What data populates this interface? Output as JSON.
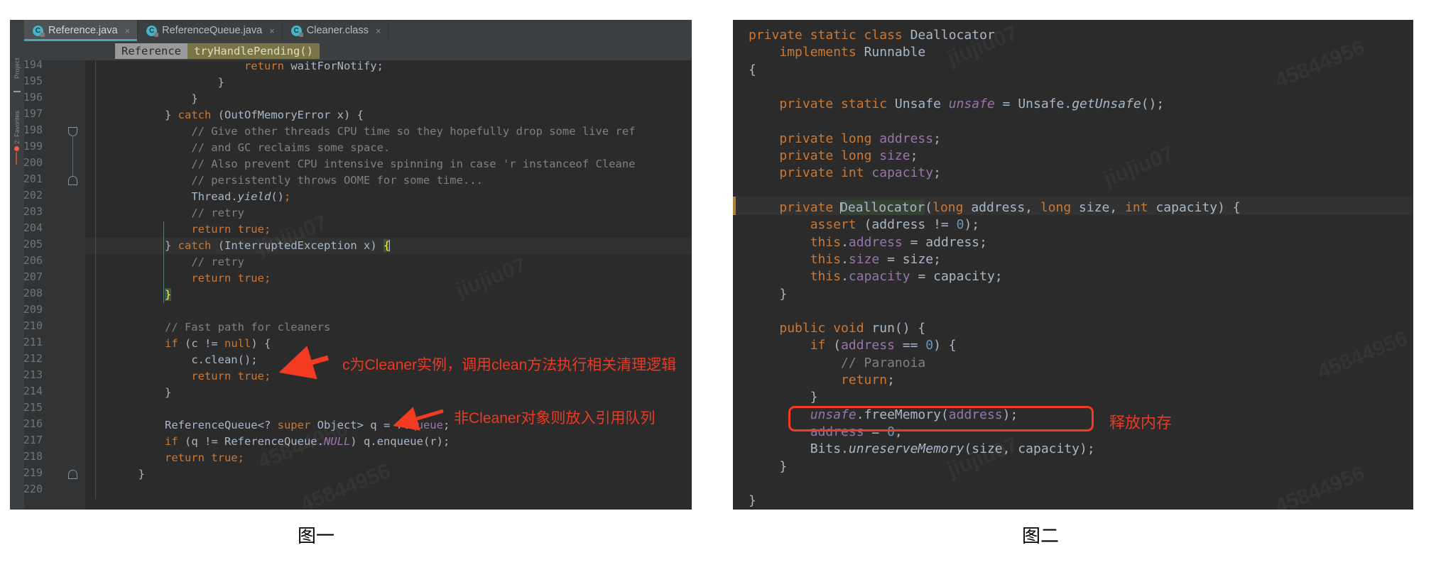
{
  "figure1": {
    "caption": "图一",
    "tabs": [
      {
        "label": "Reference.java",
        "icon": "java-class-icon",
        "close": "×",
        "active": true
      },
      {
        "label": "ReferenceQueue.java",
        "icon": "java-class-icon",
        "close": "×",
        "active": false
      },
      {
        "label": "Cleaner.class",
        "icon": "java-class-icon",
        "close": "×",
        "active": false
      }
    ],
    "breadcrumb": {
      "class": "Reference",
      "method": "tryHandlePending()"
    },
    "toolstrip": {
      "label_top": "Project",
      "label_bottom": "2: Favorites"
    },
    "gutter": {
      "first_line": 194,
      "last_line": 220
    },
    "code_lines": [
      {
        "n": 194,
        "html": "                        <span class='kw'>return</span> <span class='txt'>waitForNotify</span><span class='txt'>;</span>"
      },
      {
        "n": 195,
        "html": "                    <span class='txt'>}</span>"
      },
      {
        "n": 196,
        "html": "                <span class='txt'>}</span>"
      },
      {
        "n": 197,
        "html": "            <span class='txt'>}</span> <span class='kw'>catch</span> <span class='txt'>(OutOfMemoryError x) {</span>"
      },
      {
        "n": 198,
        "html": "                <span class='cmt'>// Give other threads CPU time so they hopefully drop some live ref</span>"
      },
      {
        "n": 199,
        "html": "                <span class='cmt'>// and GC reclaims some space.</span>"
      },
      {
        "n": 200,
        "html": "                <span class='cmt'>// Also prevent CPU intensive spinning in case 'r instanceof Cleane</span>"
      },
      {
        "n": 201,
        "html": "                <span class='cmt'>// persistently throws OOME for some time...</span>"
      },
      {
        "n": 202,
        "html": "                <span class='txt'>Thread.</span><span class='ital txt'>yield</span><span class='txt'>()</span><span class='kw'>;</span>"
      },
      {
        "n": 203,
        "html": "                <span class='cmt'>// retry</span>"
      },
      {
        "n": 204,
        "html": "                <span class='kw'>return true;</span>"
      },
      {
        "n": 205,
        "html": "            <span class='txt'>}</span> <span class='kw'>catch</span> <span class='txt'>(InterruptedException x)</span> <span class='brace-hl'>{</span><span class='caret'></span>"
      },
      {
        "n": 206,
        "html": "                <span class='cmt'>// retry</span>"
      },
      {
        "n": 207,
        "html": "                <span class='kw'>return true;</span>"
      },
      {
        "n": 208,
        "html": "            <span class='brace-hl'>}</span>"
      },
      {
        "n": 209,
        "html": ""
      },
      {
        "n": 210,
        "html": "            <span class='cmt'>// Fast path for cleaners</span>"
      },
      {
        "n": 211,
        "html": "            <span class='kw'>if</span> <span class='txt'>(c !=</span> <span class='kw'>null</span><span class='txt'>) {</span>"
      },
      {
        "n": 212,
        "html": "                <span class='txt'>c.clean();</span>"
      },
      {
        "n": 213,
        "html": "                <span class='kw'>return true;</span>"
      },
      {
        "n": 214,
        "html": "            <span class='txt'>}</span>"
      },
      {
        "n": 215,
        "html": ""
      },
      {
        "n": 216,
        "html": "            <span class='txt'>ReferenceQueue&lt;? </span><span class='kw'>super</span><span class='txt'> Object&gt; q = r.</span><span class='fld'>queue</span><span class='txt'>;</span>"
      },
      {
        "n": 217,
        "html": "            <span class='kw'>if</span> <span class='txt'>(q != ReferenceQueue.</span><span class='sfld'>NULL</span><span class='txt'>) q.enqueue(r);</span>"
      },
      {
        "n": 218,
        "html": "            <span class='kw'>return true;</span>"
      },
      {
        "n": 219,
        "html": "        <span class='txt'>}</span>"
      },
      {
        "n": 220,
        "html": ""
      }
    ],
    "annotations": [
      {
        "text": "c为Cleaner实例，调用clean方法执行相关清理逻辑",
        "name": "annotation-cleaner-instance"
      },
      {
        "text": "非Cleaner对象则放入引用队列",
        "name": "annotation-reference-queue"
      }
    ],
    "watermarks": [
      "jiujiu07",
      "45844956"
    ]
  },
  "figure2": {
    "caption": "图二",
    "code_lines": [
      {
        "html": "<span class='kw'>private static class </span><span class='txt'>Deallocator</span>"
      },
      {
        "html": "    <span class='kw'>implements </span><span class='txt'>Runnable</span>"
      },
      {
        "html": "<span class='txt'>{</span>"
      },
      {
        "html": ""
      },
      {
        "html": "    <span class='kw'>private static </span><span class='txt'>Unsafe </span><span class='sfld'>unsafe</span><span class='txt'> = Unsafe.</span><span class='ital txt'>getUnsafe</span><span class='txt'>();</span>"
      },
      {
        "html": ""
      },
      {
        "html": "    <span class='kw'>private long </span><span class='fld'>address</span><span class='txt'>;</span>"
      },
      {
        "html": "    <span class='kw'>private long </span><span class='fld'>size</span><span class='txt'>;</span>"
      },
      {
        "html": "    <span class='kw'>private int </span><span class='fld'>capacity</span><span class='txt'>;</span>"
      },
      {
        "html": ""
      },
      {
        "html": "    <span class='kw'>private </span><span class='ident-hl'><span class='caret'></span><span class='txt'>Deallocator</span></span><span class='txt'>(</span><span class='kw'>long </span><span class='txt'>address, </span><span class='kw'>long </span><span class='txt'>size, </span><span class='kw'>int </span><span class='txt'>capacity) {</span>"
      },
      {
        "html": "        <span class='kw'>assert </span><span class='txt'>(address != </span><span class='num'>0</span><span class='txt'>);</span>"
      },
      {
        "html": "        <span class='kw'>this</span><span class='txt'>.</span><span class='fld'>address</span><span class='txt'> = address;</span>"
      },
      {
        "html": "        <span class='kw'>this</span><span class='txt'>.</span><span class='fld'>size</span><span class='txt'> = size;</span>"
      },
      {
        "html": "        <span class='kw'>this</span><span class='txt'>.</span><span class='fld'>capacity</span><span class='txt'> = capacity;</span>"
      },
      {
        "html": "    <span class='txt'>}</span>"
      },
      {
        "html": ""
      },
      {
        "html": "    <span class='kw'>public void </span><span class='txt'>run() {</span>"
      },
      {
        "html": "        <span class='kw'>if </span><span class='txt'>(</span><span class='fld'>address</span><span class='txt'> == </span><span class='num'>0</span><span class='txt'>) {</span>"
      },
      {
        "html": "            <span class='cmt'>// Paranoia</span>"
      },
      {
        "html": "            <span class='kw'>return</span><span class='txt'>;</span>"
      },
      {
        "html": "        <span class='txt'>}</span>"
      },
      {
        "html": "        <span class='sfld'>unsafe</span><span class='txt'>.freeMemory(</span><span class='fld'>address</span><span class='txt'>);</span>"
      },
      {
        "html": "        <span class='fld'>address</span><span class='txt'> = </span><span class='num'>0</span><span class='txt'>;</span>"
      },
      {
        "html": "        <span class='txt'>Bits.</span><span class='ital txt'>unreserveMemory</span><span class='txt'>(size, capacity);</span>"
      },
      {
        "html": "    <span class='txt'>}</span>"
      },
      {
        "html": ""
      },
      {
        "html": "<span class='txt'>}</span>"
      }
    ],
    "annotations": [
      {
        "text": "释放内存",
        "name": "annotation-free-memory"
      }
    ],
    "highlight_box": "unsafe.freeMemory(address);",
    "watermarks": [
      "jiujiu07",
      "45844956"
    ]
  },
  "colors": {
    "annotation_red": "#e83b25",
    "box_red": "#f23b21",
    "editor_bg": "#2b2b2b",
    "panel_bg": "#3c3f41",
    "tab_accent": "#4aa8b5"
  }
}
